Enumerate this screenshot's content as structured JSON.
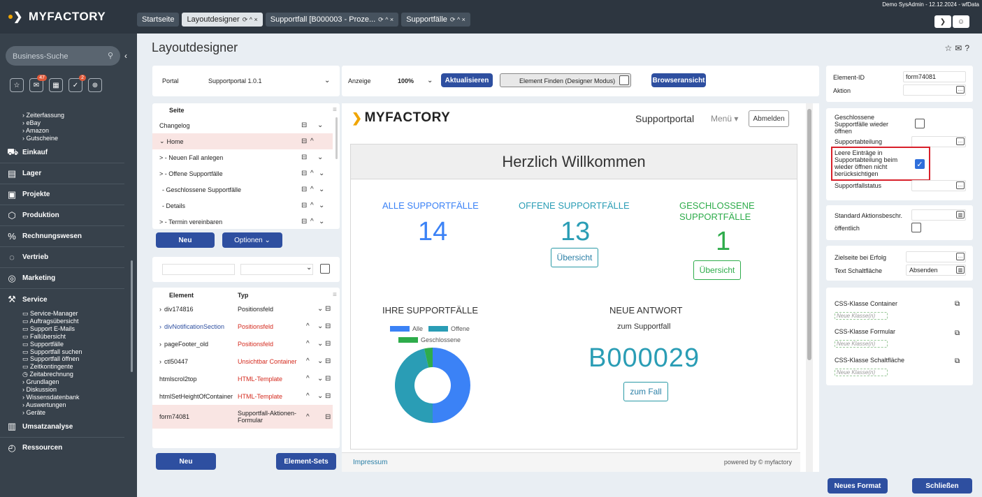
{
  "app": {
    "logo": "MYFACTORY",
    "user_info": "Demo SysAdmin - 12.12.2024 - wfData"
  },
  "tabs": [
    {
      "label": "Startseite",
      "controls": ""
    },
    {
      "label": "Layoutdesigner",
      "controls": "⟳ ^ ×"
    },
    {
      "label": "Supportfall [B000003 - Proze...",
      "controls": "⟳ ^ ×"
    },
    {
      "label": "Supportfälle",
      "controls": "⟳ ^ ×"
    }
  ],
  "sidebar": {
    "search_placeholder": "Business-Suche",
    "top_subitems": [
      "Zeiterfassung",
      "eBay",
      "Amazon",
      "Gutscheine"
    ],
    "main_items": [
      "Einkauf",
      "Lager",
      "Projekte",
      "Produktion",
      "Rechnungswesen",
      "Vertrieb",
      "Marketing",
      "Service"
    ],
    "service_items": [
      "Service-Manager",
      "Auftragsübersicht",
      "Support E-Mails",
      "Fallübersicht",
      "Supportfälle",
      "Supportfall suchen",
      "Supportfall öffnen",
      "Zeitkontingente",
      "Zeitabrechnung",
      "Grundlagen",
      "Diskussion",
      "Wissensdatenbank",
      "Auswertungen",
      "Geräte"
    ],
    "bottom_items": [
      "Umsatzanalyse",
      "Ressourcen"
    ],
    "badges": {
      "mail": "47",
      "check": "2"
    }
  },
  "page": {
    "title": "Layoutdesigner"
  },
  "portal": {
    "label": "Portal",
    "value": "Supportportal 1.0.1"
  },
  "toolbar": {
    "anzeige_label": "Anzeige",
    "zoom": "100%",
    "refresh": "Aktualisieren",
    "find": "Element Finden (Designer Modus)",
    "browser": "Browseransicht"
  },
  "pages_tree": {
    "header": "Seite",
    "rows": [
      "Changelog",
      "Home",
      "> - Neuen Fall anlegen",
      "> - Offene Supportfälle",
      "- Geschlossene Supportfälle",
      "- Details",
      "> - Termin vereinbaren"
    ],
    "new_btn": "Neu",
    "options_btn": "Optionen ⌄"
  },
  "elements": {
    "col_element": "Element",
    "col_type": "Typ",
    "rows": [
      {
        "name": "div174816",
        "type": "Positionsfeld"
      },
      {
        "name": "divNotificationSection",
        "type": "Positionsfeld"
      },
      {
        "name": "pageFooter_old",
        "type": "Positionsfeld"
      },
      {
        "name": "ctl50447",
        "type": "Unsichtbar Container"
      },
      {
        "name": "htmlscrol2top",
        "type": "HTML-Template"
      },
      {
        "name": "htmlSetHeightOfContainer",
        "type": "HTML-Template"
      },
      {
        "name": "form74081",
        "type": "Supportfall-Aktionen-Formular"
      }
    ],
    "new_btn": "Neu",
    "sets_btn": "Element-Sets"
  },
  "preview": {
    "brand": "MYFACTORY",
    "portal_name": "Supportportal",
    "menu": "Menü ▾",
    "logout": "Abmelden",
    "welcome": "Herzlich Willkommen",
    "all_label": "ALLE SUPPORTFÄLLE",
    "all_value": "14",
    "open_label": "OFFENE SUPPORTFÄLLE",
    "open_value": "13",
    "closed_label_1": "GESCHLOSSENE",
    "closed_label_2": "SUPPORTFÄLLE",
    "closed_value": "1",
    "overview_btn": "Übersicht",
    "my_cases": "IHRE SUPPORTFÄLLE",
    "legend": [
      "Alle",
      "Offene",
      "Geschlossene"
    ],
    "new_answer": "NEUE ANTWORT",
    "new_answer_sub": "zum Supportfall",
    "case_number": "B000029",
    "to_case": "zum Fall",
    "impressum": "Impressum",
    "powered": "powered by © myfactory"
  },
  "chart_data": {
    "type": "pie",
    "categories": [
      "Alle",
      "Offene",
      "Geschlossene"
    ],
    "values": [
      14,
      13,
      1
    ],
    "colors": [
      "#3b82f6",
      "#2a9db5",
      "#2eac4b"
    ]
  },
  "props": {
    "element_id_label": "Element-ID",
    "element_id_value": "form74081",
    "aktion_label": "Aktion",
    "reopen_label": "Geschlossene Supportfälle wieder öffnen",
    "dept_label": "Supportabteilung",
    "ignore_label": "Leere Einträge in Supportabteilung beim wieder öffnen nicht berücksichtigen",
    "status_label": "Supportfallstatus",
    "std_action_label": "Standard Aktionsbeschr.",
    "public_label": "öffentlich",
    "target_label": "Zielseite bei Erfolg",
    "btn_text_label": "Text Schaltfläche",
    "btn_text_value": "Absenden",
    "css_container": "CSS-Klasse Container",
    "css_form": "CSS-Klasse Formular",
    "css_button": "CSS-Klasse Schaltfläche",
    "new_class": "Neue Klasse(n)",
    "new_format_btn": "Neues Format",
    "close_btn": "Schließen"
  }
}
